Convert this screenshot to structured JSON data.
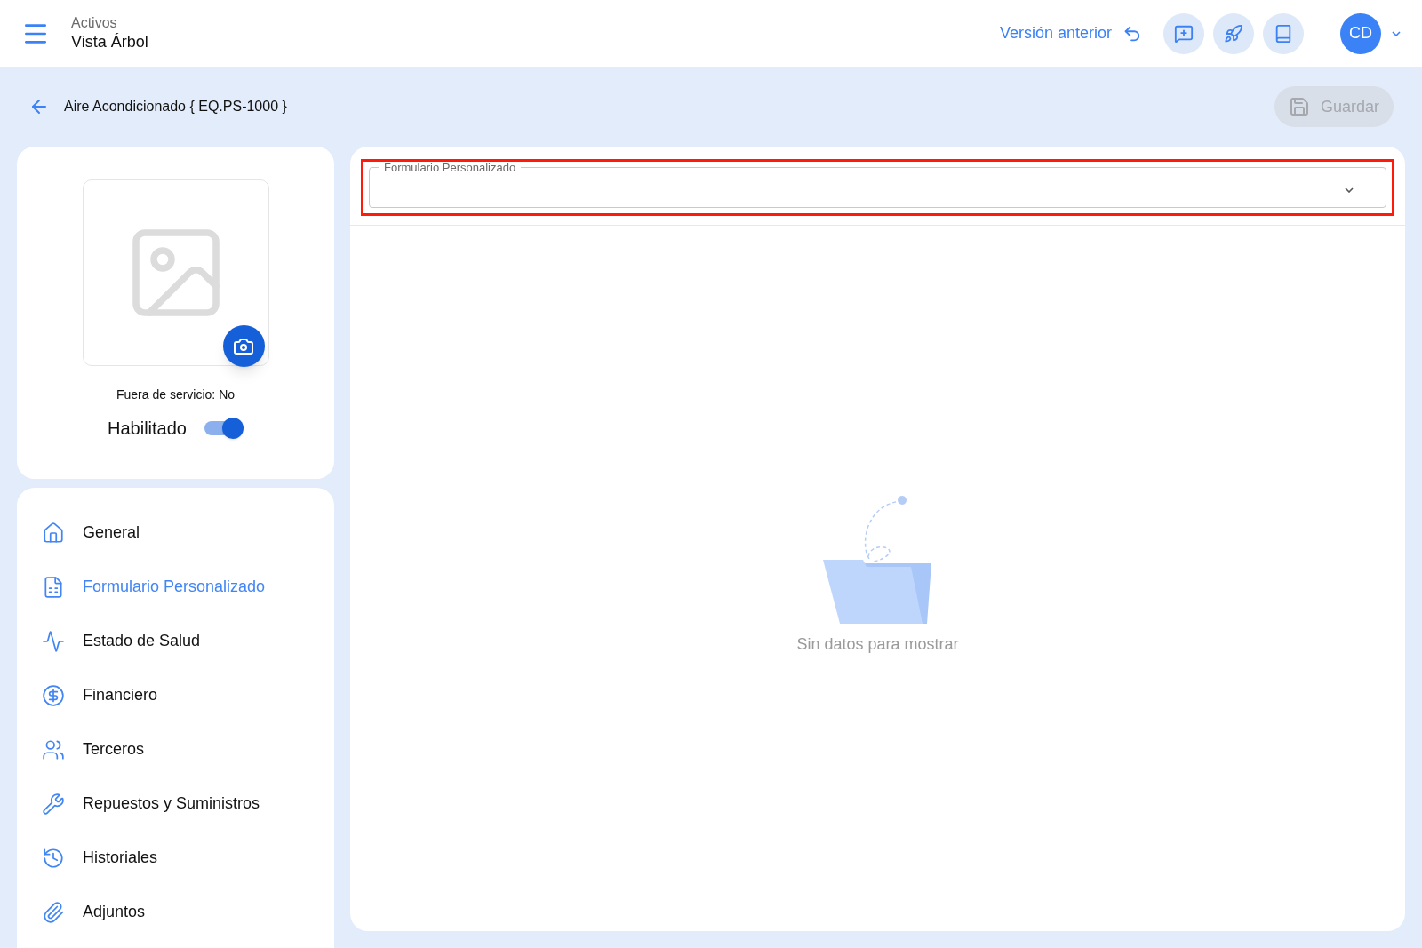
{
  "header": {
    "section": "Activos",
    "title": "Vista Árbol",
    "previous_version": "Versión anterior",
    "avatar": "CD"
  },
  "toolbar": {
    "title": "Aire Acondicionado { EQ.PS-1000 }",
    "save": {
      "label": "Guardar",
      "disabled": true
    }
  },
  "asset": {
    "out_of_service": "Fuera de servicio: No",
    "enabled": {
      "label": "Habilitado",
      "on": true
    }
  },
  "sidebar": {
    "items": [
      {
        "kind": "home",
        "label": "General",
        "selected": false
      },
      {
        "kind": "form",
        "label": "Formulario Personalizado",
        "selected": true
      },
      {
        "kind": "health",
        "label": "Estado de Salud",
        "selected": false
      },
      {
        "kind": "money",
        "label": "Financiero",
        "selected": false
      },
      {
        "kind": "people",
        "label": "Terceros",
        "selected": false
      },
      {
        "kind": "tools",
        "label": "Repuestos y Suministros",
        "selected": false
      },
      {
        "kind": "history",
        "label": "Historiales",
        "selected": false
      },
      {
        "kind": "attach",
        "label": "Adjuntos",
        "selected": false
      }
    ]
  },
  "form_select": {
    "label": "Formulario Personalizado",
    "highlighted": true
  },
  "empty_state": {
    "message": "Sin datos para mostrar"
  }
}
